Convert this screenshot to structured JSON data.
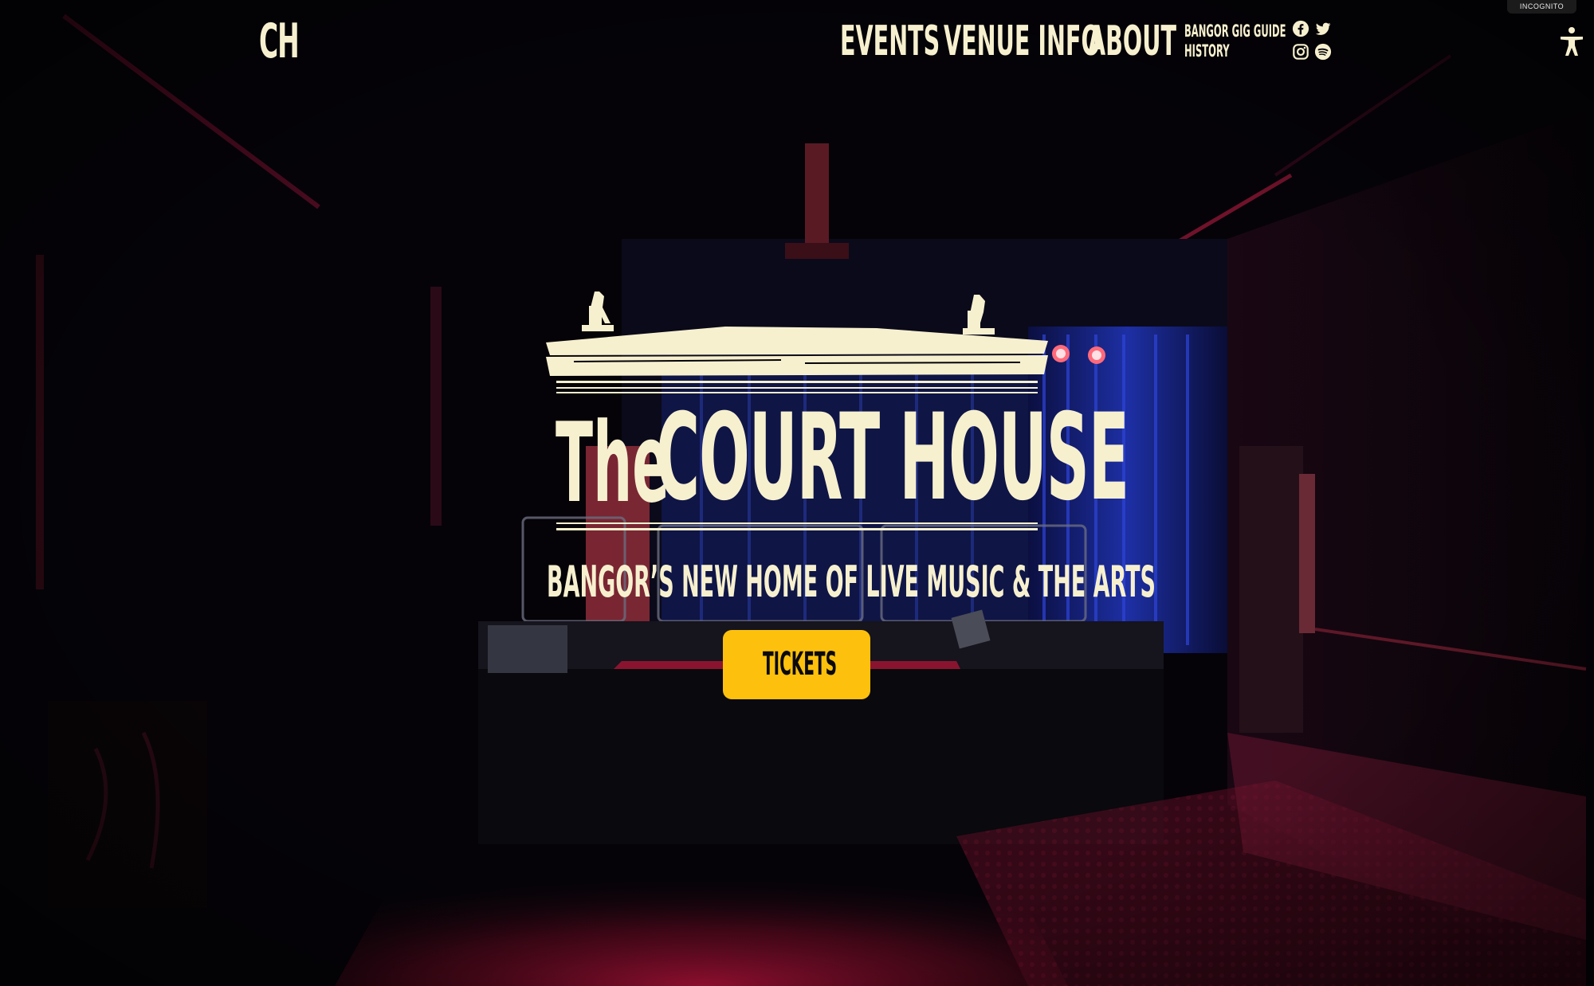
{
  "header": {
    "logo_text": "CH",
    "nav": {
      "events": "EVENTS",
      "venue_info": "VENUE INFO",
      "about": "ABOUT",
      "gig_guide": "BANGOR GIG GUIDE",
      "history": "HISTORY"
    },
    "social_icons": [
      "facebook-icon",
      "twitter-icon",
      "instagram-icon",
      "spotify-icon"
    ]
  },
  "browser": {
    "incognito_label": "INCOGNITO"
  },
  "hero": {
    "title_prefix": "The",
    "title_main": "COURT HOUSE",
    "subtitle": "BANGOR’S NEW HOME OF LIVE MUSIC & THE ARTS",
    "tickets_label": "TICKETS"
  },
  "colors": {
    "cream": "#f7f0cf",
    "ticket_yellow": "#fdc10d",
    "background": "#050308",
    "stage_red": "#b3123a",
    "curtain_blue": "#1c2f9e"
  }
}
